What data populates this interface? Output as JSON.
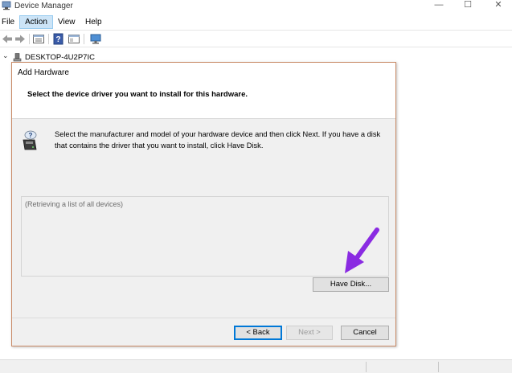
{
  "window": {
    "title": "Device Manager",
    "controls": {
      "minimize": "—",
      "maximize": "☐",
      "close": "✕"
    }
  },
  "menu": {
    "file": "File",
    "action": "Action",
    "view": "View",
    "help": "Help"
  },
  "tree": {
    "computer_name": "DESKTOP-4U2P7IC",
    "expand_glyph": "⌄"
  },
  "dialog": {
    "title": "Add Hardware",
    "heading": "Select the device driver you want to install for this hardware.",
    "instructions": "Select the manufacturer and model of your hardware device and then click Next. If you have a disk that contains the driver that you want to install, click Have Disk.",
    "list_status": "(Retrieving a list of all devices)",
    "buttons": {
      "have_disk": "Have Disk...",
      "back": "< Back",
      "next": "Next >",
      "cancel": "Cancel"
    }
  },
  "colors": {
    "annotation_arrow": "#8a2be2",
    "menu_highlight": "#cce4f7",
    "dialog_border": "#c98a66",
    "default_button_border": "#0078d7"
  }
}
